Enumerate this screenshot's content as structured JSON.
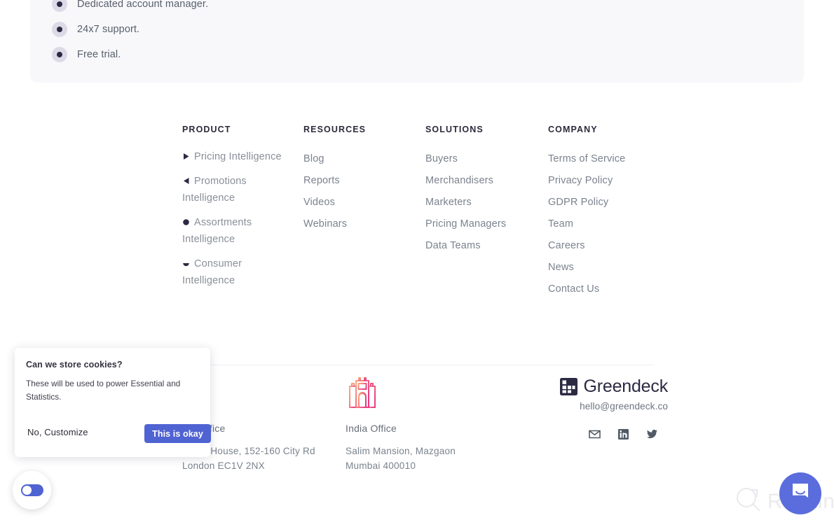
{
  "features": {
    "items": [
      {
        "text": "Dedicated account manager.",
        "icon": "bullet-dot-icon"
      },
      {
        "text": "24x7 support.",
        "icon": "bullet-dot-icon"
      },
      {
        "text": "Free trial.",
        "icon": "bullet-dot-icon"
      }
    ]
  },
  "footer": {
    "columns": [
      {
        "key": "product",
        "title": "PRODUCT",
        "links": [
          {
            "label": "Pricing Intelligence",
            "icon": "play-triangle-right-icon"
          },
          {
            "label": "Promotions Intelligence",
            "icon": "play-triangle-left-icon"
          },
          {
            "label": "Assortments Intelligence",
            "icon": "circle-dot-icon"
          },
          {
            "label": "Consumer Intelligence",
            "icon": "half-circle-icon"
          }
        ]
      },
      {
        "key": "resources",
        "title": "RESOURCES",
        "links": [
          {
            "label": "Blog"
          },
          {
            "label": "Reports"
          },
          {
            "label": "Videos"
          },
          {
            "label": "Webinars"
          }
        ]
      },
      {
        "key": "solutions",
        "title": "SOLUTIONS",
        "links": [
          {
            "label": "Buyers"
          },
          {
            "label": "Merchandisers"
          },
          {
            "label": "Marketers"
          },
          {
            "label": "Pricing Managers"
          },
          {
            "label": "Data Teams"
          }
        ]
      },
      {
        "key": "company",
        "title": "COMPANY",
        "links": [
          {
            "label": "Terms of Service"
          },
          {
            "label": "Privacy Policy"
          },
          {
            "label": "GDPR Policy"
          },
          {
            "label": "Team"
          },
          {
            "label": "Careers"
          },
          {
            "label": "News"
          },
          {
            "label": "Contact Us"
          }
        ]
      }
    ],
    "offices": [
      {
        "key": "uk",
        "icon": "big-ben-icon",
        "name": "UK Office",
        "address_line1": "Kemp House, 152-160 City Rd",
        "address_line2": "London EC1V 2NX"
      },
      {
        "key": "india",
        "icon": "gateway-of-india-icon",
        "name": "India Office",
        "address_line1": "Salim Mansion, Mazgaon",
        "address_line2": "Mumbai 400010"
      }
    ],
    "brand": {
      "logo_icon": "greendeck-grid-logo-icon",
      "name": "Greendeck",
      "email": "hello@greendeck.co",
      "socials": [
        {
          "name": "email-icon",
          "label": "Email"
        },
        {
          "name": "linkedin-icon",
          "label": "LinkedIn"
        },
        {
          "name": "twitter-icon",
          "label": "Twitter"
        }
      ]
    }
  },
  "cookie_dialog": {
    "title": "Can we store cookies?",
    "body": "These will be used to power Essential and Statistics.",
    "deny_label": "No, Customize",
    "accept_label": "This is okay",
    "accept_color": "#4f63d2"
  },
  "widgets": {
    "accessibility_toggle": {
      "icon": "accessibility-toggle-icon",
      "color": "#4f63d2"
    },
    "chat_button": {
      "icon": "intercom-chat-icon",
      "color": "#5b6ddc"
    },
    "watermark": {
      "text": "Revain",
      "icon": "revain-logo-icon"
    }
  }
}
